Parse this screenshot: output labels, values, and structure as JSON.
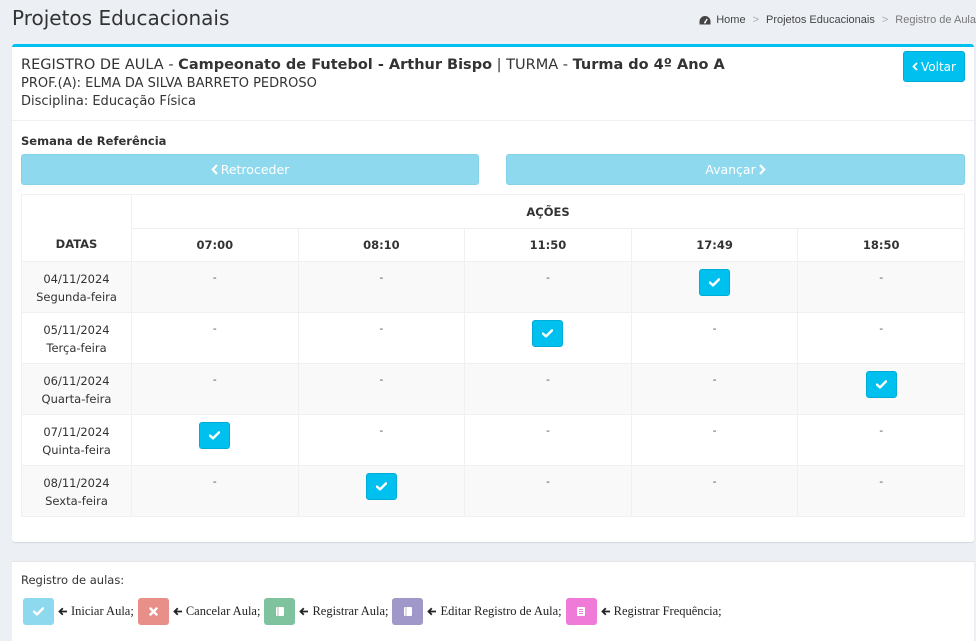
{
  "header": {
    "title": "Projetos Educacionais",
    "breadcrumb": [
      "Home",
      "Projetos Educacionais",
      "Registro de Aula"
    ]
  },
  "record": {
    "prefix": "REGISTRO DE AULA - ",
    "project": "Campeonato de Futebol - Arthur Bispo",
    "turma_prefix": " | TURMA - ",
    "turma": "Turma do 4º Ano A",
    "professor": "PROF.(A): ELMA DA SILVA BARRETO PEDROSO",
    "disciplina": "Disciplina: Educação Física",
    "back_label": "Voltar"
  },
  "week": {
    "label": "Semana de Referência",
    "prev_label": "Retroceder",
    "next_label": "Avançar"
  },
  "table": {
    "actions_header": "AÇÕES",
    "dates_header": "DATAS",
    "times": [
      "07:00",
      "08:10",
      "11:50",
      "17:49",
      "18:50"
    ],
    "empty_mark": "-",
    "rows": [
      {
        "date": "04/11/2024",
        "weekday": "Segunda-feira",
        "checked_slot": 3
      },
      {
        "date": "05/11/2024",
        "weekday": "Terça-feira",
        "checked_slot": 2
      },
      {
        "date": "06/11/2024",
        "weekday": "Quarta-feira",
        "checked_slot": 4
      },
      {
        "date": "07/11/2024",
        "weekday": "Quinta-feira",
        "checked_slot": 0
      },
      {
        "date": "08/11/2024",
        "weekday": "Sexta-feira",
        "checked_slot": 1
      }
    ]
  },
  "legend": {
    "title": "Registro de aulas:",
    "items": [
      {
        "label": "Iniciar Aula;",
        "color": "#8fd9ee",
        "icon": "check-icon"
      },
      {
        "label": "Cancelar Aula;",
        "color": "#e88f8a",
        "icon": "close-icon"
      },
      {
        "label": "Registrar Aula;",
        "color": "#7fc39e",
        "icon": "book-icon"
      },
      {
        "label": "Editar Registro de Aula;",
        "color": "#9f98c9",
        "icon": "book-icon"
      },
      {
        "label": "Registrar Frequência;",
        "color": "#f07ad8",
        "icon": "list-icon"
      }
    ]
  },
  "colors": {
    "accent": "#00c0ef"
  }
}
